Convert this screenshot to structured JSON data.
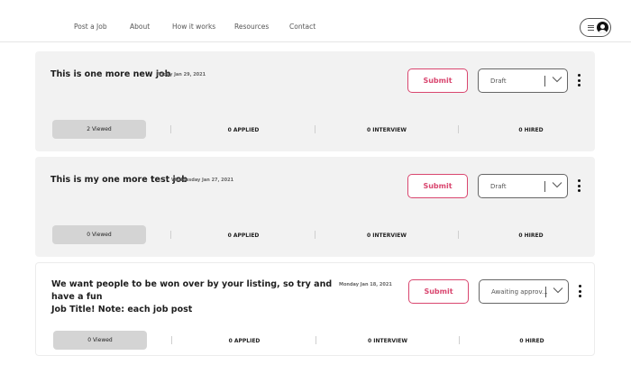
{
  "nav": {
    "links": [
      "Post a Job",
      "About",
      "How it works",
      "Resources",
      "Contact"
    ]
  },
  "jobs": [
    {
      "title": "This is one more new job",
      "date": "Friday Jan 29, 2021",
      "submit_label": "Submit",
      "status": "Draft",
      "viewed": "2 Viewed",
      "applied": "0 APPLIED",
      "interview": "0 INTERVIEW",
      "hired": "0 HIRED"
    },
    {
      "title": "This is my one more test job",
      "date": "Wednesday Jan 27, 2021",
      "submit_label": "Submit",
      "status": "Draft",
      "viewed": "0 Viewed",
      "applied": "0 APPLIED",
      "interview": "0 INTERVIEW",
      "hired": "0 HIRED"
    },
    {
      "title_line1": "We want people to be won over by your listing, so try and have a fun",
      "title_line2": "Job Title! Note: each job post",
      "date": "Monday Jan 18, 2021",
      "submit_label": "Submit",
      "status": "Awaiting approv...",
      "viewed": "0 Viewed",
      "applied": "0 APPLIED",
      "interview": "0 INTERVIEW",
      "hired": "0 HIRED"
    }
  ],
  "colors": {
    "accent": "#d9466f",
    "card_grey": "#f2f2f2",
    "pill_grey": "#d4d4d4"
  }
}
